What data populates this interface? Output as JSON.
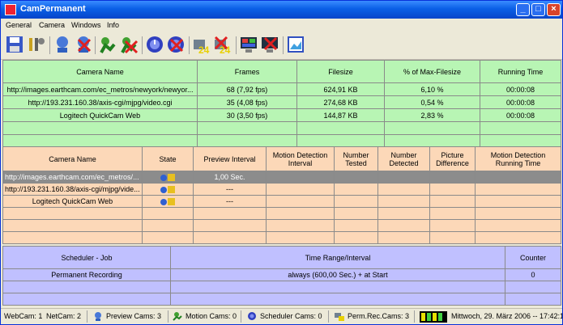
{
  "window": {
    "title": "CamPermanent"
  },
  "menu": [
    "General",
    "Camera",
    "Windows",
    "Info"
  ],
  "toolbar": {
    "icons": [
      "save-icon",
      "settings-icon",
      "add-webcam-icon",
      "remove-webcam-icon",
      "add-motion-icon",
      "remove-motion-icon",
      "add-scheduler-icon",
      "remove-scheduler-icon",
      "add-permanent-icon",
      "remove-permanent-icon",
      "monitor-icon",
      "remove-monitor-icon",
      "picture-icon"
    ]
  },
  "table1": {
    "headers": [
      "Camera Name",
      "Frames",
      "Filesize",
      "% of Max-Filesize",
      "Running Time"
    ],
    "rows": [
      [
        "http://images.earthcam.com/ec_metros/newyork/newyor...",
        "68  (7,92 fps)",
        "624,91 KB",
        "6,10 %",
        "00:00:08"
      ],
      [
        "http://193.231.160.38/axis-cgi/mjpg/video.cgi",
        "35  (4,08 fps)",
        "274,68 KB",
        "0,54 %",
        "00:00:08"
      ],
      [
        "Logitech QuickCam Web",
        "30  (3,50 fps)",
        "144,87 KB",
        "2,83 %",
        "00:00:08"
      ]
    ]
  },
  "table2": {
    "headers": [
      "Camera Name",
      "State",
      "Preview Interval",
      "Motion Detection Interval",
      "Number Tested",
      "Number Detected",
      "Picture Difference",
      "Motion Detection Running Time"
    ],
    "rows": [
      [
        "http://images.earthcam.com/ec_metros/...",
        "",
        "1,00 Sec.",
        "",
        "",
        "",
        "",
        ""
      ],
      [
        "http://193.231.160.38/axis-cgi/mjpg/vide...",
        "",
        "---",
        "",
        "",
        "",
        "",
        ""
      ],
      [
        "Logitech QuickCam Web",
        "",
        "---",
        "",
        "",
        "",
        "",
        ""
      ]
    ]
  },
  "table3": {
    "headers": [
      "Scheduler - Job",
      "Time Range/Interval",
      "Counter"
    ],
    "rows": [
      [
        "Permanent Recording",
        "always (600,00 Sec.) + at Start",
        "0"
      ]
    ]
  },
  "status": {
    "webcam": "WebCam: 1",
    "netcam": "NetCam: 2",
    "preview": "Preview Cams: 3",
    "motion": "Motion Cams: 0",
    "scheduler": "Scheduler Cams: 0",
    "perm": "Perm.Rec.Cams: 3",
    "datetime": "Mittwoch, 29. März 2006 -- 17:42:1"
  }
}
